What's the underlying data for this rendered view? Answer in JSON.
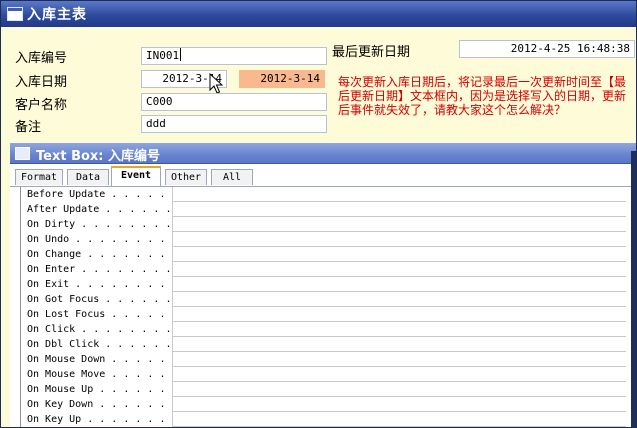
{
  "window": {
    "title": "入库主表"
  },
  "form": {
    "labels": {
      "receipt_no": "入库编号",
      "date": "入库日期",
      "customer": "客户名称",
      "remark": "备注",
      "last_update": "最后更新日期"
    },
    "values": {
      "receipt_no": "IN001",
      "date": "2012-3-14",
      "date_copy": "2012-3-14",
      "customer": "C000",
      "remark": "ddd",
      "last_update": "2012-4-25 16:48:38"
    },
    "note": "每次更新入库日期后，将记录最后一次更新时间至【最后更新日期】文本框内，因为是选择写入的日期，更新后事件就失效了，请教大家这个怎么解决？"
  },
  "property_sheet": {
    "title": "Text Box: 入库编号",
    "tabs": [
      "Format",
      "Data",
      "Event",
      "Other",
      "All"
    ],
    "active_tab": "Event",
    "properties": [
      "Before Update . . . . .",
      "After Update . . . . . .",
      "On Dirty . . . . . . . .",
      "On Undo . . . . . . . .",
      "On Change . . . . . . .",
      "On Enter . . . . . . . .",
      "On Exit . . . . . . . .",
      "On Got Focus . . . . . .",
      "On Lost Focus . . . . .",
      "On Click . . . . . . . .",
      "On Dbl Click . . . . . .",
      "On Mouse Down . . . . .",
      "On Mouse Move . . . . .",
      "On Mouse Up . . . . . .",
      "On Key Down . . . . . .",
      "On Key Up . . . . . . ."
    ]
  },
  "colors": {
    "title_bar": "#2e4b9b",
    "form_background": "#fefbd8",
    "note_text": "#d40000",
    "highlight_field": "#f7b98d",
    "active_tab_accent": "#e9a430"
  }
}
